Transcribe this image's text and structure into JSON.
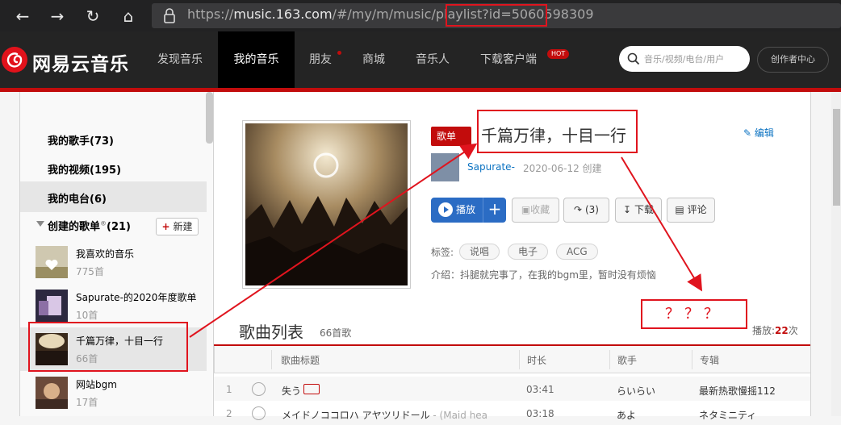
{
  "browser": {
    "url_prefix": "https://",
    "url_host": "music.163.com",
    "url_path": "/#/my/m/music/playlist?id=5060598309"
  },
  "site": {
    "brand": "网易云音乐",
    "nav": [
      "发现音乐",
      "我的音乐",
      "朋友",
      "商城",
      "音乐人",
      "下载客户端"
    ],
    "hot_badge": "HOT",
    "search_placeholder": "音乐/视频/电台/用户",
    "creator_center": "创作者中心",
    "colors": {
      "nav_bg": "#242424",
      "accent": "#c20c0c",
      "link": "#0c73c2"
    }
  },
  "sidebar": {
    "my_singers": "我的歌手(73)",
    "my_videos": "我的视频(195)",
    "my_radio": "我的电台(6)",
    "created_playlists": "创建的歌单",
    "created_count": "(21)",
    "new_button": "新建",
    "playlists": [
      {
        "name": "我喜欢的音乐",
        "count": "775首"
      },
      {
        "name": "Sapurate-的2020年度歌单",
        "count": "10首"
      },
      {
        "name": "千篇万律，十目一行",
        "count": "66首"
      },
      {
        "name": "网站bgm",
        "count": "17首"
      }
    ]
  },
  "playlist": {
    "tag": "歌单",
    "title": "千篇万律，十目一行",
    "edit": "编辑",
    "creator": "Sapurate-",
    "created": "2020-06-12 创建",
    "buttons": {
      "play": "播放",
      "collect": "收藏",
      "share": "(3)",
      "download": "下载",
      "comment": "评论"
    },
    "tags_label": "标签:",
    "tags": [
      "说唱",
      "电子",
      "ACG"
    ],
    "intro": "介绍：抖腿就完事了，在我的bgm里，暂时没有烦恼"
  },
  "song_list": {
    "title": "歌曲列表",
    "count": "66首歌",
    "plays_label": "播放:",
    "plays": "22",
    "plays_unit": "次",
    "headers": [
      "歌曲标题",
      "时长",
      "歌手",
      "专辑"
    ],
    "rows": [
      {
        "index": "1",
        "title": "失う",
        "duration": "03:41",
        "artist": "らいらい",
        "album": "最新热歌慢摇112"
      },
      {
        "index": "2",
        "title": "メイドノココロハ アヤツリドール",
        "title_sub": " - (Maid hea",
        "duration": "03:18",
        "artist": "あよ",
        "album": "ネタミニティ"
      }
    ]
  },
  "annotation": {
    "question": "？？？"
  }
}
